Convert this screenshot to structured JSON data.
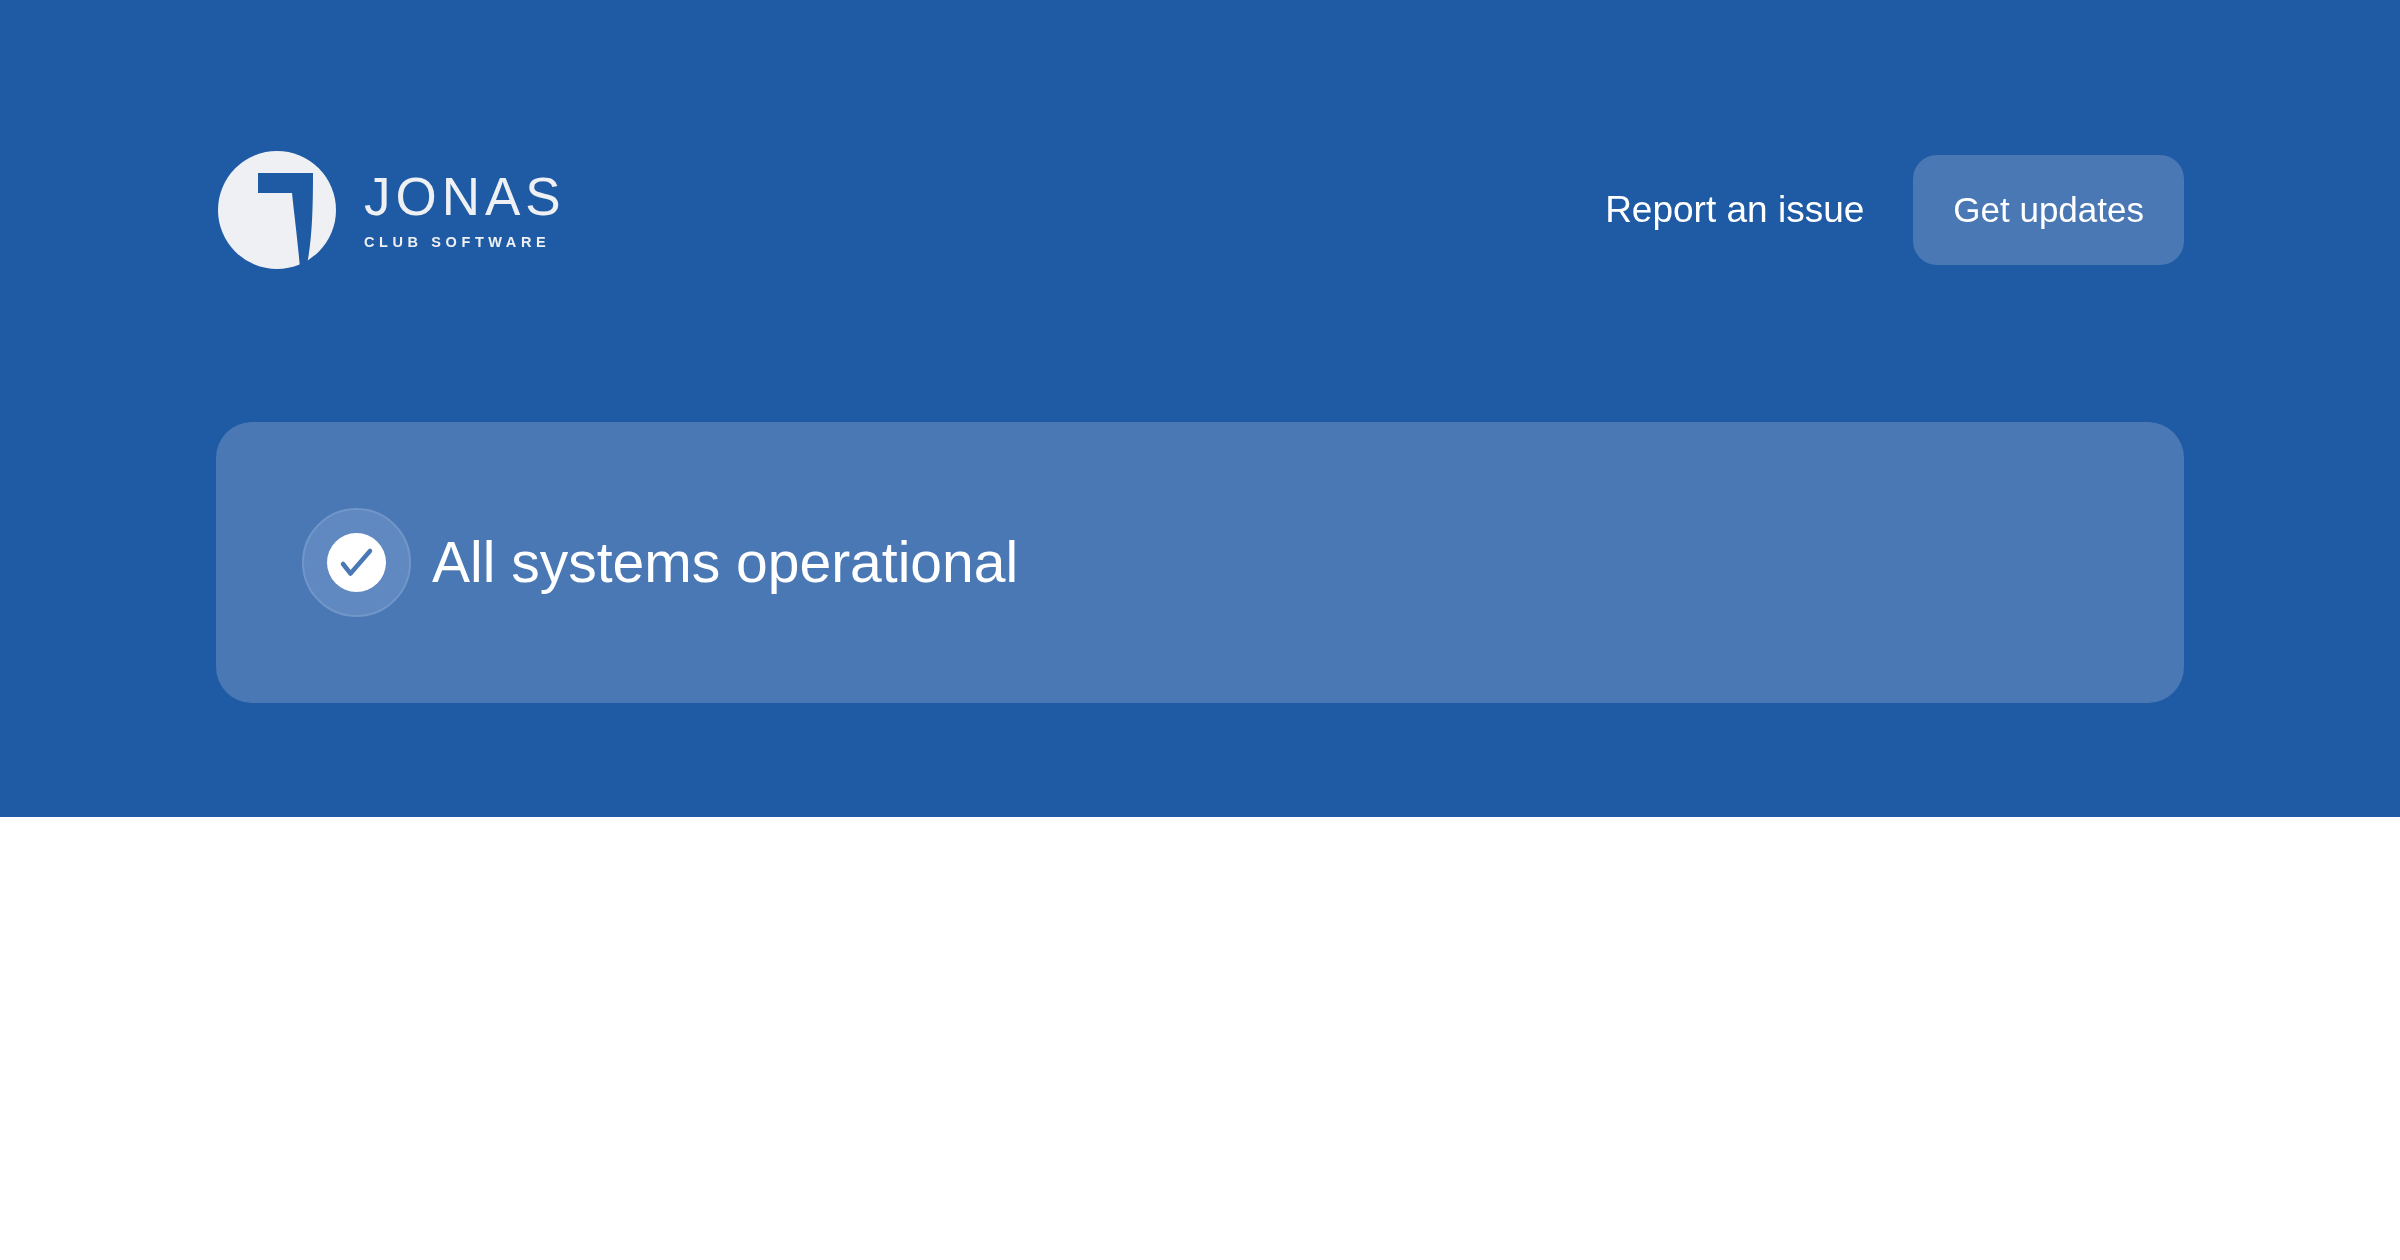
{
  "header": {
    "logo": {
      "name": "JONAS",
      "tagline": "CLUB SOFTWARE"
    },
    "links": [
      {
        "label": "Report an issue",
        "kind": "link"
      },
      {
        "label": "Get updates",
        "kind": "button"
      }
    ]
  },
  "status": {
    "kind": "operational",
    "message": "All systems operational"
  }
}
